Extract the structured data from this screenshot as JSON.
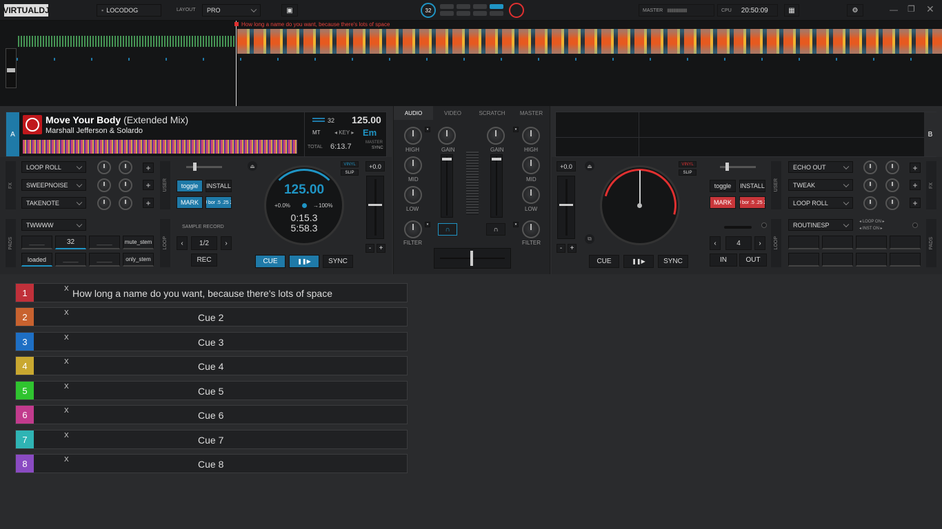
{
  "topbar": {
    "logo": "VIRTUALDJ",
    "user": "LOCODOG",
    "layout_label": "LAYOUT",
    "layout_value": "PRO",
    "beat_count": "32",
    "master_label": "MASTER",
    "cpu_label": "CPU",
    "clock": "20:50:09"
  },
  "waveform": {
    "cue_text": "How long a name do you want, because there's lots of space"
  },
  "deckA": {
    "letter": "A",
    "title": "Move Your Body",
    "title_suffix": "(Extended Mix)",
    "artist": "Marshall Jefferson & Solardo",
    "bpm": "125.00",
    "beats": "32",
    "key_label": "KEY",
    "key_prefix": "MT",
    "key_value": "Em",
    "total_label": "TOTAL",
    "total_time": "6:13.7",
    "master_label": "MASTER",
    "sync_label": "SYNC",
    "fx": [
      "LOOP ROLL",
      "SWEEPNOISE",
      "TAKENOTE"
    ],
    "fx_side": "FX",
    "user_side": "USER",
    "pads_side": "PADS",
    "loop_side": "LOOP",
    "user_btns": [
      "toggle",
      "INSTALL",
      "MARK",
      "J bor .5 .25 2"
    ],
    "sampler_sel": "TWWWW",
    "sampler_pads": [
      "____",
      "32",
      "____",
      "mute_stem",
      "loaded",
      "____",
      "____",
      "only_stem"
    ],
    "sample_record": "SAMPLE RECORD",
    "loop_value": "1/2",
    "rec": "REC",
    "platter_bpm": "125.00",
    "pitch": "+0.0%",
    "range": "→100%",
    "elapsed": "0:15.3",
    "remain": "5:58.3",
    "vinyl": "VINYL",
    "slip": "SLIP",
    "pitch_value": "+0.0",
    "cue": "CUE",
    "play": "❚❚▶",
    "sync": "SYNC"
  },
  "mixer": {
    "tabs": [
      "AUDIO",
      "VIDEO",
      "SCRATCH",
      "MASTER"
    ],
    "left": [
      "HIGH",
      "MID",
      "LOW",
      "FILTER"
    ],
    "right": [
      "HIGH",
      "MID",
      "LOW",
      "FILTER"
    ],
    "gain": "GAIN"
  },
  "deckB": {
    "letter": "B",
    "pitch_value": "+0.0",
    "vinyl": "VINYL",
    "slip": "SLIP",
    "user_btns": [
      "toggle",
      "INSTALL",
      "MARK",
      "J bor .5 .25 2"
    ],
    "fx": [
      "ECHO OUT",
      "TWEAK",
      "LOOP ROLL"
    ],
    "fx_side": "FX",
    "user_side": "USER",
    "pads_side": "PADS",
    "loop_side": "LOOP",
    "sampler_sel": "ROUTINESP",
    "loop_on": "LOOP ON",
    "inst_on": "INST ON",
    "loop_value": "4",
    "in": "IN",
    "out": "OUT",
    "cue": "CUE",
    "play": "❚❚▶",
    "sync": "SYNC"
  },
  "cues": [
    {
      "num": "1",
      "x": "X",
      "name": "How long a name do you want, because there's lots of space",
      "color": "#c0303a"
    },
    {
      "num": "2",
      "x": "X",
      "name": "Cue 2",
      "color": "#c8622f"
    },
    {
      "num": "3",
      "x": "X",
      "name": "Cue 3",
      "color": "#1e6fc4"
    },
    {
      "num": "4",
      "x": "X",
      "name": "Cue 4",
      "color": "#c9a830"
    },
    {
      "num": "5",
      "x": "X",
      "name": "Cue 5",
      "color": "#2fc42f"
    },
    {
      "num": "6",
      "x": "X",
      "name": "Cue 6",
      "color": "#c23b8d"
    },
    {
      "num": "7",
      "x": "X",
      "name": "Cue 7",
      "color": "#2fb4b4"
    },
    {
      "num": "8",
      "x": "X",
      "name": "Cue 8",
      "color": "#8a4bc2"
    }
  ],
  "colors": {
    "accent": "#1f94c4",
    "red": "#e03030",
    "deck_bg": "#232426"
  }
}
